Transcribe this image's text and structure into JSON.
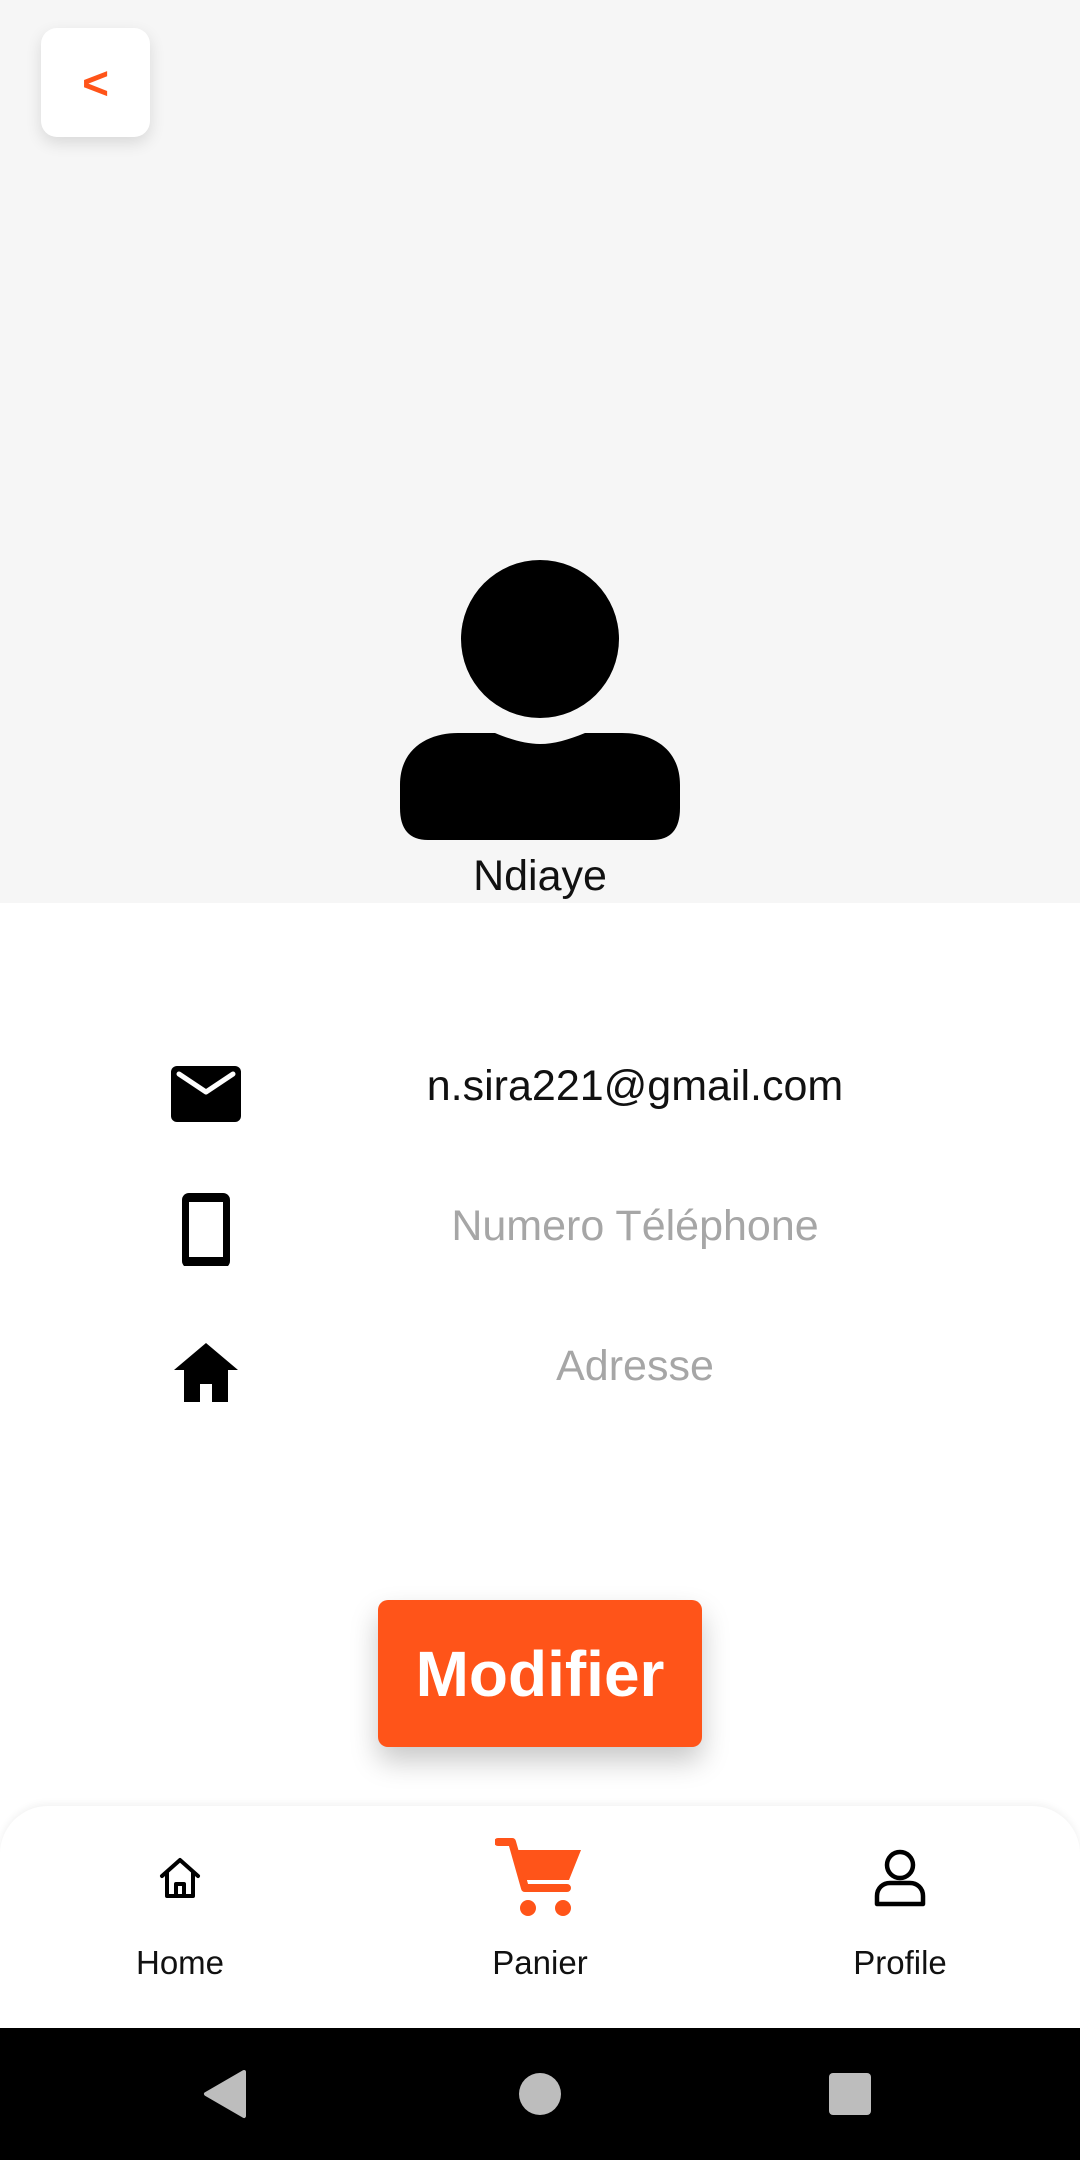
{
  "header": {
    "back_label": "<"
  },
  "profile": {
    "name": "Ndiaye",
    "avatar_icon": "person-icon"
  },
  "info": {
    "email": "n.sira221@gmail.com",
    "phone_placeholder": "Numero Téléphone",
    "address_placeholder": "Adresse"
  },
  "actions": {
    "modify_label": "Modifier"
  },
  "bottom_nav": {
    "items": [
      {
        "label": "Home",
        "icon": "home-icon"
      },
      {
        "label": "Panier",
        "icon": "cart-icon"
      },
      {
        "label": "Profile",
        "icon": "profile-icon"
      }
    ]
  },
  "colors": {
    "accent": "#ff5419",
    "background_top": "#f6f6f6",
    "placeholder_text": "#a6a6a6"
  }
}
